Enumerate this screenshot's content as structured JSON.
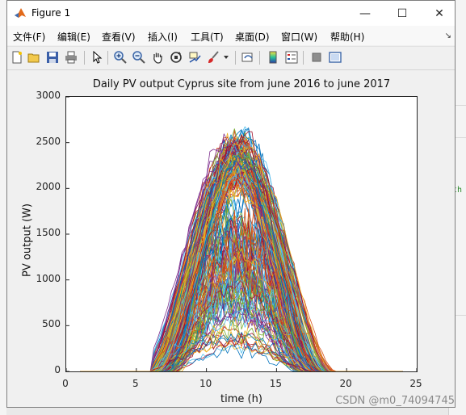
{
  "window": {
    "title": "Figure 1",
    "controls": {
      "minimize": "—",
      "maximize": "☐",
      "close": "✕"
    }
  },
  "menu": {
    "items": [
      "文件(F)",
      "编辑(E)",
      "查看(V)",
      "插入(I)",
      "工具(T)",
      "桌面(D)",
      "窗口(W)",
      "帮助(H)"
    ],
    "corner": "↘"
  },
  "toolbar": {
    "icons": [
      "new-figure-icon",
      "open-file-icon",
      "save-icon",
      "print-icon",
      "pointer-icon",
      "zoom-in-icon",
      "zoom-out-icon",
      "pan-hand-icon",
      "rotate-3d-icon",
      "data-cursor-icon",
      "brush-icon",
      "link-plot-icon",
      "colorbar-icon",
      "legend-icon",
      "hide-plot-tools-icon",
      "show-plot-tools-icon"
    ]
  },
  "chart_data": {
    "type": "line",
    "title": "Daily PV output Cyprus site from june 2016 to june 2017",
    "xlabel": "time (h)",
    "ylabel": "PV output (W)",
    "xlim": [
      0,
      25
    ],
    "ylim": [
      0,
      3000
    ],
    "xticks": [
      "0",
      "5",
      "10",
      "15",
      "20",
      "25"
    ],
    "yticks": [
      "0",
      "500",
      "1000",
      "1500",
      "2000",
      "2500",
      "3000"
    ],
    "grid": false,
    "series_count_approx": 365,
    "x_start": 1,
    "x_end": 24,
    "nonzero_start": 6.5,
    "nonzero_end": 20,
    "peak_time": 12.5,
    "peak_max": 2790,
    "colors": [
      "#0072bd",
      "#d95319",
      "#edb120",
      "#7e2f8e",
      "#77ac30",
      "#4dbeee",
      "#a2142f"
    ]
  },
  "watermark": "CSDN @m0_74094745",
  "background_app": {
    "snippet": "th"
  }
}
